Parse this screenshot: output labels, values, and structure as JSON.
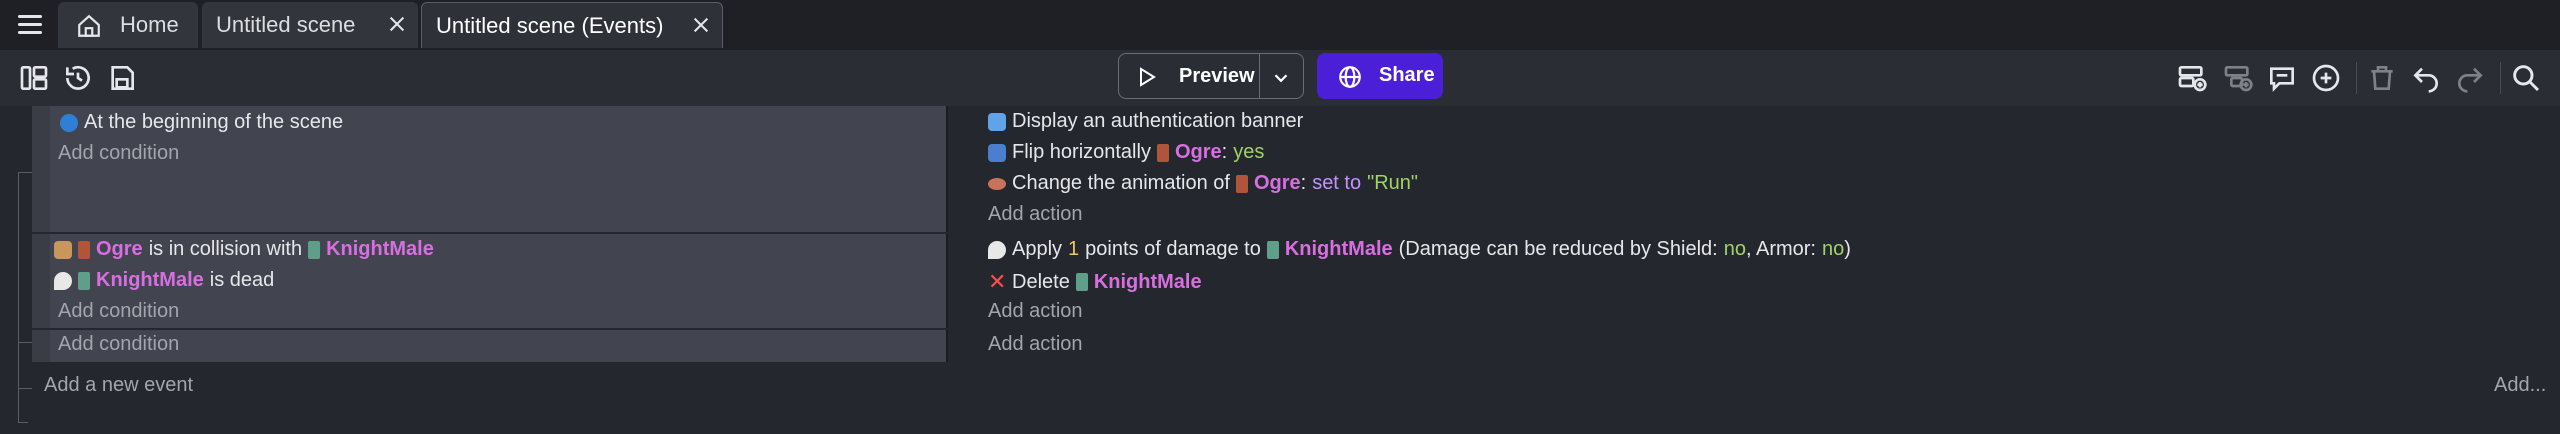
{
  "tabs": [
    {
      "label": "Home"
    },
    {
      "label": "Untitled scene"
    },
    {
      "label": "Untitled scene (Events)"
    }
  ],
  "toolbar": {
    "preview_label": "Preview",
    "share_label": "Share"
  },
  "events": [
    {
      "conditions": [
        {
          "text": "At the beginning of the scene"
        }
      ],
      "add_condition": "Add condition",
      "actions": [
        {
          "text": "Display an authentication banner"
        },
        {
          "pre": "Flip horizontally",
          "object": "Ogre",
          "sep": ":",
          "value": "yes"
        },
        {
          "pre": "Change the animation of",
          "object": "Ogre",
          "sep": ":",
          "op": "set to",
          "value": "\"Run\""
        }
      ],
      "add_action": "Add action"
    },
    {
      "conditions": [
        {
          "object": "Ogre",
          "mid": "is in collision with",
          "object2": "KnightMale"
        },
        {
          "object": "KnightMale",
          "mid": "is dead"
        }
      ],
      "add_condition": "Add condition",
      "actions": [
        {
          "pre": "Apply",
          "num": "1",
          "mid": "points of damage to",
          "object": "KnightMale",
          "tail1": "(Damage can be reduced by Shield:",
          "val1": "no",
          "tail2": ", Armor:",
          "val2": "no",
          "tail3": ")"
        },
        {
          "pre": "Delete",
          "object": "KnightMale"
        }
      ],
      "add_action": "Add action"
    },
    {
      "add_condition": "Add condition",
      "add_action": "Add action"
    }
  ],
  "add_new_event": "Add a new event",
  "add_more": "Add..."
}
